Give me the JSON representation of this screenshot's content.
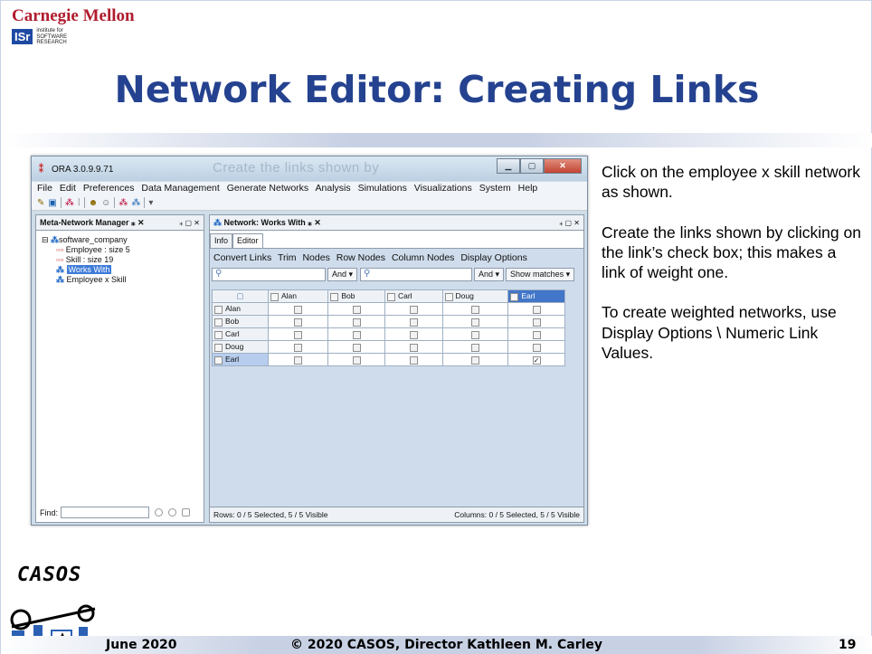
{
  "header": {
    "cmu_logo": "Carnegie Mellon",
    "isr_logo": "ISr",
    "isr_sub": [
      "institute for",
      "SOFTWARE",
      "RESEARCH"
    ],
    "title": "Network Editor: Creating Links"
  },
  "window": {
    "app_name": "ORA 3.0.9.9.71",
    "ghost_title": "Create the links shown by",
    "menu": [
      "File",
      "Edit",
      "Preferences",
      "Data Management",
      "Generate Networks",
      "Analysis",
      "Simulations",
      "Visualizations",
      "System",
      "Help"
    ],
    "toolbar_icons": [
      "wand-icon",
      "save-icon",
      "node-icon",
      "node-list-icon",
      "user-icon",
      "user-group-icon",
      "network-icon",
      "network-multi-icon",
      "dropdown-icon"
    ],
    "left_pane": {
      "tab_label": "Meta-Network Manager",
      "tree": {
        "root": "software_company",
        "items": [
          "Employee : size 5",
          "Skill : size 19",
          "Works With",
          "Employee x Skill"
        ],
        "selected_index": 2
      },
      "find_label": "Find:"
    },
    "right_pane": {
      "tab_label": "Network: Works With",
      "subtabs": [
        "Info",
        "Editor"
      ],
      "editor_menu": [
        "Convert Links",
        "Trim",
        "Nodes",
        "Row Nodes",
        "Column Nodes",
        "Display Options"
      ],
      "and_label": "And",
      "show_matches": "Show matches",
      "columns": [
        "Alan",
        "Bob",
        "Carl",
        "Doug",
        "Earl"
      ],
      "rows": [
        "Alan",
        "Bob",
        "Carl",
        "Doug",
        "Earl"
      ],
      "checked": [
        [
          4,
          4
        ]
      ],
      "selected_row": 4,
      "selected_col": 4,
      "status_rows": "Rows: 0 / 5 Selected, 5 / 5 Visible",
      "status_cols": "Columns: 0 / 5 Selected, 5 / 5 Visible"
    }
  },
  "side_text": [
    "Click on the employee x skill network as shown.",
    "Create the links shown by clicking on the link’s check box; this makes a link of weight one.",
    "To create weighted networks, use Display Options \\ Numeric Link Values."
  ],
  "footer": {
    "logo": "CASOS",
    "date": "June 2020",
    "copyright": "© 2020 CASOS, Director Kathleen M. Carley",
    "page": "19"
  }
}
